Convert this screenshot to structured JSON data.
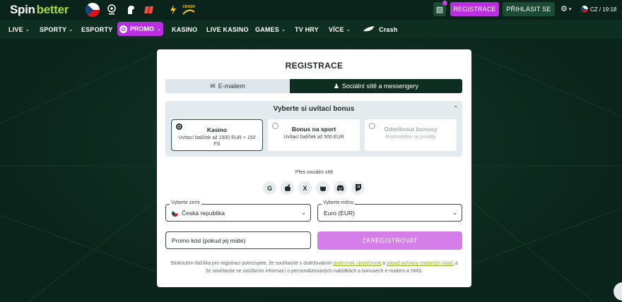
{
  "header": {
    "logo_spin": "Spin",
    "logo_better": "better",
    "gift_badge": "1",
    "register_label": "REGISTRACE",
    "login_label": "PŘIHLÁSIT SE",
    "lang_time": "CZ / 19:18",
    "crash_partner_text": "CRASH"
  },
  "nav": {
    "items": [
      {
        "label": "LIVE"
      },
      {
        "label": "SPORTY"
      },
      {
        "label": "ESPORTY"
      },
      {
        "label": "PROMO"
      },
      {
        "label": "KASINO"
      },
      {
        "label": "LIVE KASINO"
      },
      {
        "label": "GAMES"
      },
      {
        "label": "TV HRY"
      },
      {
        "label": "VÍCE"
      },
      {
        "label": "Crash"
      }
    ]
  },
  "modal": {
    "title": "REGISTRACE",
    "tab_email": "E-mailem",
    "tab_social": "Sociální sítě a messengery",
    "bonus_title": "Vyberte si uvítací bonus",
    "bonuses": [
      {
        "title": "Kasino",
        "subtitle": "Uvítací balíček až 1500 EUR + 150 FS"
      },
      {
        "title": "Bonus na sport",
        "subtitle": "Uvítací balíček až 500 EUR"
      },
      {
        "title": "Odmítnout bonusy",
        "subtitle": "Rozhodněte se později"
      }
    ],
    "social_label": "Přes sociální sítě",
    "social_icons": [
      "G",
      "",
      "X",
      "",
      "",
      ""
    ],
    "country_label": "Vyberte zemi",
    "country_value": "Česká republika",
    "currency_label": "Vyberte měnu",
    "currency_value": "Euro (EUR)",
    "promo_placeholder": "Promo kód (pokud jej máte)",
    "submit_label": "ZAREGISTROVAT",
    "terms_1": "Stisknutím tlačítka pro registraci potvrzujete, že souhlasíte s dodržováním ",
    "terms_link1": "podmínek společnosti",
    "terms_2": " a ",
    "terms_link2": "zásad ochrany osobních údajů",
    "terms_3": " a že souhlasíte se zasíláním informací o personalizovaných nabídkách a bonusech e-mailem a SMS."
  },
  "colors": {
    "background": "#0b241b",
    "accent": "#b82ee0",
    "submit": "#d57ee9",
    "brand_green": "#a4d944"
  }
}
